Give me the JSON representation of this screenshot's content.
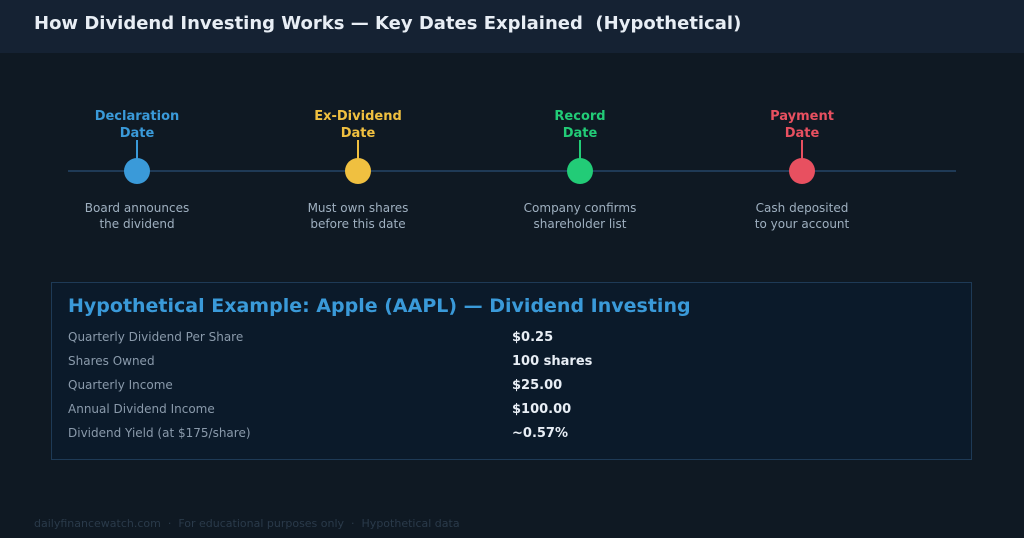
{
  "header": {
    "title": "How Dividend Investing Works — Key Dates Explained  (Hypothetical)"
  },
  "timeline": {
    "steps": [
      {
        "label_line1": "Declaration",
        "label_line2": "Date",
        "desc_line1": "Board announces",
        "desc_line2": "the dividend",
        "color": "#3a9ad9"
      },
      {
        "label_line1": "Ex-Dividend",
        "label_line2": "Date",
        "desc_line1": "Must own shares",
        "desc_line2": "before this date",
        "color": "#f0c040"
      },
      {
        "label_line1": "Record",
        "label_line2": "Date",
        "desc_line1": "Company confirms",
        "desc_line2": "shareholder list",
        "color": "#22cc77"
      },
      {
        "label_line1": "Payment",
        "label_line2": "Date",
        "desc_line1": "Cash deposited",
        "desc_line2": "to your account",
        "color": "#e85060"
      }
    ]
  },
  "example": {
    "title": "Hypothetical Example: Apple (AAPL) — Dividend Investing",
    "rows": [
      {
        "label": "Quarterly Dividend Per Share",
        "value": "$0.25"
      },
      {
        "label": "Shares Owned",
        "value": "100 shares"
      },
      {
        "label": "Quarterly Income",
        "value": "$25.00"
      },
      {
        "label": "Annual Dividend Income",
        "value": "$100.00"
      },
      {
        "label": "Dividend Yield (at $175/share)",
        "value": "~0.57%"
      }
    ]
  },
  "footer": {
    "text": "dailyfinancewatch.com  ·  For educational purposes only  ·  Hypothetical data"
  }
}
